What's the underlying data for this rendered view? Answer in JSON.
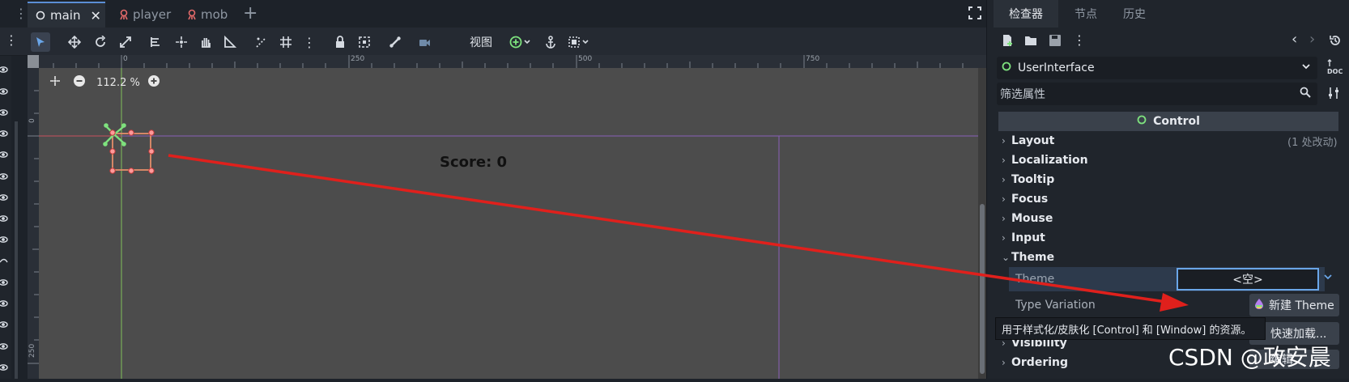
{
  "tabs": [
    {
      "label": "main",
      "icon": "circle-icon",
      "active": true
    },
    {
      "label": "player",
      "icon": "node-icon"
    },
    {
      "label": "mob",
      "icon": "node-icon"
    }
  ],
  "toolbar": {
    "view_label": "视图"
  },
  "ruler": {
    "top_ticks": [
      "0",
      "250",
      "500",
      "750"
    ],
    "left_ticks": [
      "0",
      "250"
    ]
  },
  "viewport": {
    "zoom_level": "112.2 %",
    "score_text": "Score: 0"
  },
  "dock": {
    "tabs": [
      "检查器",
      "节点",
      "历史"
    ],
    "node_name": "UserInterface",
    "filter_placeholder": "筛选属性",
    "class_header": "Control",
    "sections": [
      "Layout",
      "Localization",
      "Tooltip",
      "Focus",
      "Mouse",
      "Input",
      "Theme",
      "Visibility",
      "Ordering"
    ],
    "layout_note": "(1 处改动)",
    "theme_property_label": "Theme",
    "theme_value": "<空>",
    "type_variation_label": "Type Variation",
    "new_theme_label": "新建 Theme",
    "quick_load_label": "快速加载...",
    "edit_label": "编辑"
  },
  "tooltip_text": "用于样式化/皮肤化 [Control] 和 [Window] 的资源。",
  "watermark": "CSDN @政安晨",
  "colors": {
    "accent": "#6aa6e8",
    "arrow": "#e0201c",
    "viewport_bg": "#4c4c4c",
    "gizmo_green": "#7ee27e",
    "handle_red": "#ff6b6b"
  }
}
